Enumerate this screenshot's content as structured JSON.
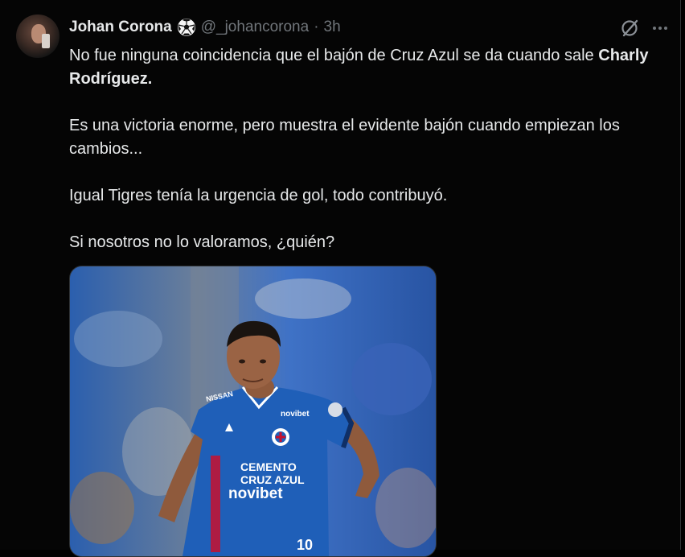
{
  "tweet": {
    "author_name": "Johan Corona",
    "author_emoji_icon": "soccer-ball-icon",
    "handle": "@_johancorona",
    "separator": "·",
    "time": "3h",
    "line1": "No fue ninguna coincidencia que el bajón de Cruz Azul se da cuando sale",
    "line1_bold": "Charly Rodríguez",
    "line1_end": ".",
    "para2": "Es una victoria enorme, pero muestra el evidente bajón cuando empiezan los cambios...",
    "para3": "Igual Tigres tenía la urgencia de gol, todo contribuyó.",
    "para4": "Si nosotros no lo valoramos, ¿quién?",
    "image": {
      "jersey_text_1": "CEMENTO",
      "jersey_text_2": "CRUZ AZUL",
      "jersey_sponsor": "novibet",
      "jersey_sponsor_small": "novibet",
      "jersey_number": "10",
      "brand_text": "NISSAN"
    }
  },
  "colors": {
    "background": "#000000",
    "text": "#e7e9ea",
    "muted": "#71767b",
    "jersey": "#1f5fb8"
  }
}
